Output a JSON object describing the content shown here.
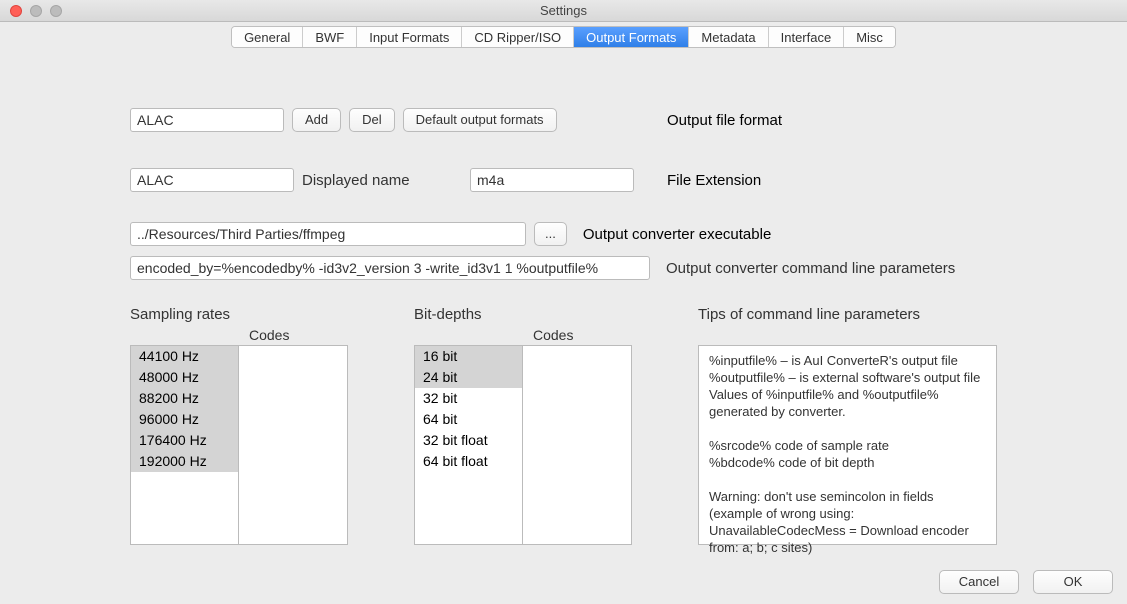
{
  "window": {
    "title": "Settings"
  },
  "tabs": [
    "General",
    "BWF",
    "Input Formats",
    "CD Ripper/ISO",
    "Output Formats",
    "Metadata",
    "Interface",
    "Misc"
  ],
  "active_tab": "Output Formats",
  "format_selector": "ALAC",
  "buttons": {
    "add": "Add",
    "del": "Del",
    "defaults": "Default output formats",
    "browse": "...",
    "cancel": "Cancel",
    "ok": "OK"
  },
  "labels": {
    "output_format": "Output file format",
    "displayed_name": "Displayed name",
    "file_ext": "File Extension",
    "converter_exe": "Output converter executable",
    "cmdline_params": "Output converter command line parameters",
    "sampling": "Sampling rates",
    "bitdepths": "Bit-depths",
    "codes": "Codes",
    "tips_title": "Tips of command line parameters"
  },
  "fields": {
    "displayed_name": "ALAC",
    "file_ext": "m4a",
    "converter_exe": "../Resources/Third Parties/ffmpeg",
    "cmdline_params": "encoded_by=%encodedby% -id3v2_version 3 -write_id3v1 1 %outputfile%"
  },
  "sampling_rates": [
    "44100 Hz",
    "48000 Hz",
    "88200 Hz",
    "96000 Hz",
    "176400 Hz",
    "192000 Hz"
  ],
  "sampling_selected": [
    0,
    1,
    2,
    3,
    4,
    5
  ],
  "sampling_codes": [],
  "bit_depths": [
    "16 bit",
    "24 bit",
    "32 bit",
    "64 bit",
    "32 bit float",
    "64 bit float"
  ],
  "bitdepth_selected": [
    0,
    1
  ],
  "bitdepth_codes": [],
  "tips": "%inputfile% – is AuI ConverteR's output file\n%outputfile% – is external software's output file\nValues of %inputfile% and %outputfile% generated by converter.\n\n%srcode% code of sample rate\n%bdcode% code of bit depth\n\nWarning: don't use semincolon in fields (example of wrong using: UnavailableCodecMess = Download encoder from: a; b; c sites)"
}
